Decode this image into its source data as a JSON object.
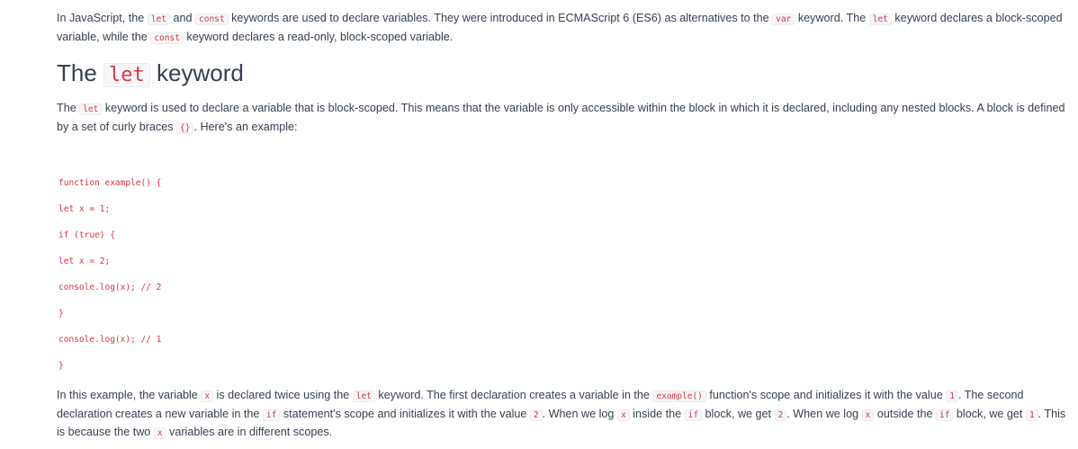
{
  "intro": {
    "t1": "In JavaScript, the ",
    "c1": "let",
    "t2": " and ",
    "c2": "const",
    "t3": " keywords are used to declare variables. They were introduced in ECMAScript 6 (ES6) as alternatives to the ",
    "c3": "var",
    "t4": " keyword. The ",
    "c4": "let",
    "t5": " keyword declares a block-scoped variable, while the ",
    "c5": "const",
    "t6": " keyword declares a read-only, block-scoped variable."
  },
  "heading": {
    "pre": "The ",
    "code": "let",
    "post": " keyword"
  },
  "para2": {
    "t1": "The ",
    "c1": "let",
    "t2": " keyword is used to declare a variable that is block-scoped. This means that the variable is only accessible within the block in which it is declared, including any nested blocks. A block is defined by a set of curly braces ",
    "c2": "{}",
    "t3": ". Here's an example:"
  },
  "code_lines": [
    "function example() {",
    "let x = 1;",
    "if (true) {",
    "let x = 2;",
    "console.log(x); // 2",
    "}",
    "console.log(x); // 1",
    "}"
  ],
  "para3": {
    "t1": "In this example, the variable ",
    "c1": "x",
    "t2": " is declared twice using the ",
    "c2": "let",
    "t3": " keyword. The first declaration creates a variable in the ",
    "c3": "example()",
    "t4": " function's scope and initializes it with the value ",
    "c4": "1",
    "t5": ". The second declaration creates a new variable in the ",
    "c5": "if",
    "t6": " statement's scope and initializes it with the value ",
    "c6": "2",
    "t7": ". When we log ",
    "c7": "x",
    "t8": " inside the ",
    "c8": "if",
    "t9": " block, we get ",
    "c9": "2",
    "t10": ". When we log ",
    "c10": "x",
    "t11": " outside the ",
    "c11": "if",
    "t12": " block, we get ",
    "c12": "1",
    "t13": ". This is because the two ",
    "c13": "x",
    "t14": " variables are in different scopes."
  },
  "colors": {
    "text": "#374151",
    "code_text": "#dc3545",
    "code_bg": "#f7f7f9"
  }
}
